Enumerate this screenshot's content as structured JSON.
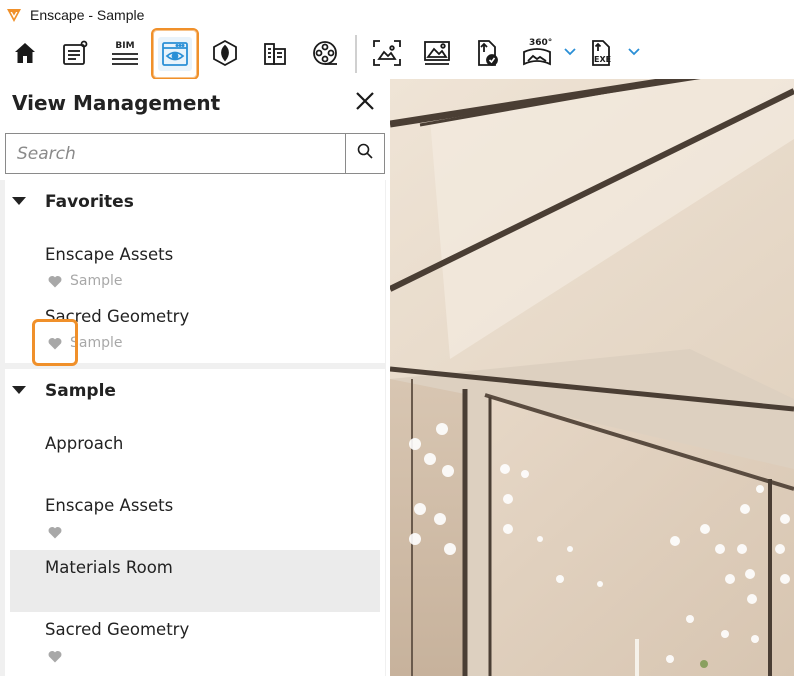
{
  "window": {
    "title": "Enscape - Sample",
    "accent": "#f0902a",
    "logo_color": "#f0902a"
  },
  "toolbar": {
    "items": [
      {
        "icon": "home-icon"
      },
      {
        "icon": "notes-icon"
      },
      {
        "icon": "bim-icon",
        "label": "BIM"
      },
      {
        "icon": "view-management-icon",
        "active": true
      },
      {
        "icon": "asset-library-icon"
      },
      {
        "icon": "building-icon"
      },
      {
        "icon": "video-editor-icon"
      },
      {
        "icon": "screenshot-icon"
      },
      {
        "icon": "batch-render-icon"
      },
      {
        "icon": "upload-icon"
      },
      {
        "icon": "panorama-360-icon",
        "label": "360°"
      },
      {
        "icon": "export-exe-icon",
        "label": "EXE"
      }
    ]
  },
  "panel": {
    "title": "View Management",
    "search": {
      "placeholder": "Search",
      "value": ""
    },
    "groups": [
      {
        "label": "Favorites",
        "items": [
          {
            "name": "Enscape Assets",
            "favorite": true,
            "subtitle": "Sample"
          },
          {
            "name": "Sacred Geometry",
            "favorite": true,
            "subtitle": "Sample"
          }
        ]
      },
      {
        "label": "Sample",
        "items": [
          {
            "name": "Approach",
            "favorite": false,
            "subtitle": ""
          },
          {
            "name": "Enscape Assets",
            "favorite": true,
            "subtitle": ""
          },
          {
            "name": "Materials Room",
            "favorite": false,
            "subtitle": "",
            "selected": true
          },
          {
            "name": "Sacred Geometry",
            "favorite": true,
            "subtitle": ""
          }
        ]
      }
    ]
  },
  "colors": {
    "heart": "#a8a8a8",
    "selected_row": "#ebebeb",
    "highlight": "#f0902a",
    "active_tab_bg": "#e9f3fb",
    "active_tab_icon": "#2a8fd6"
  }
}
